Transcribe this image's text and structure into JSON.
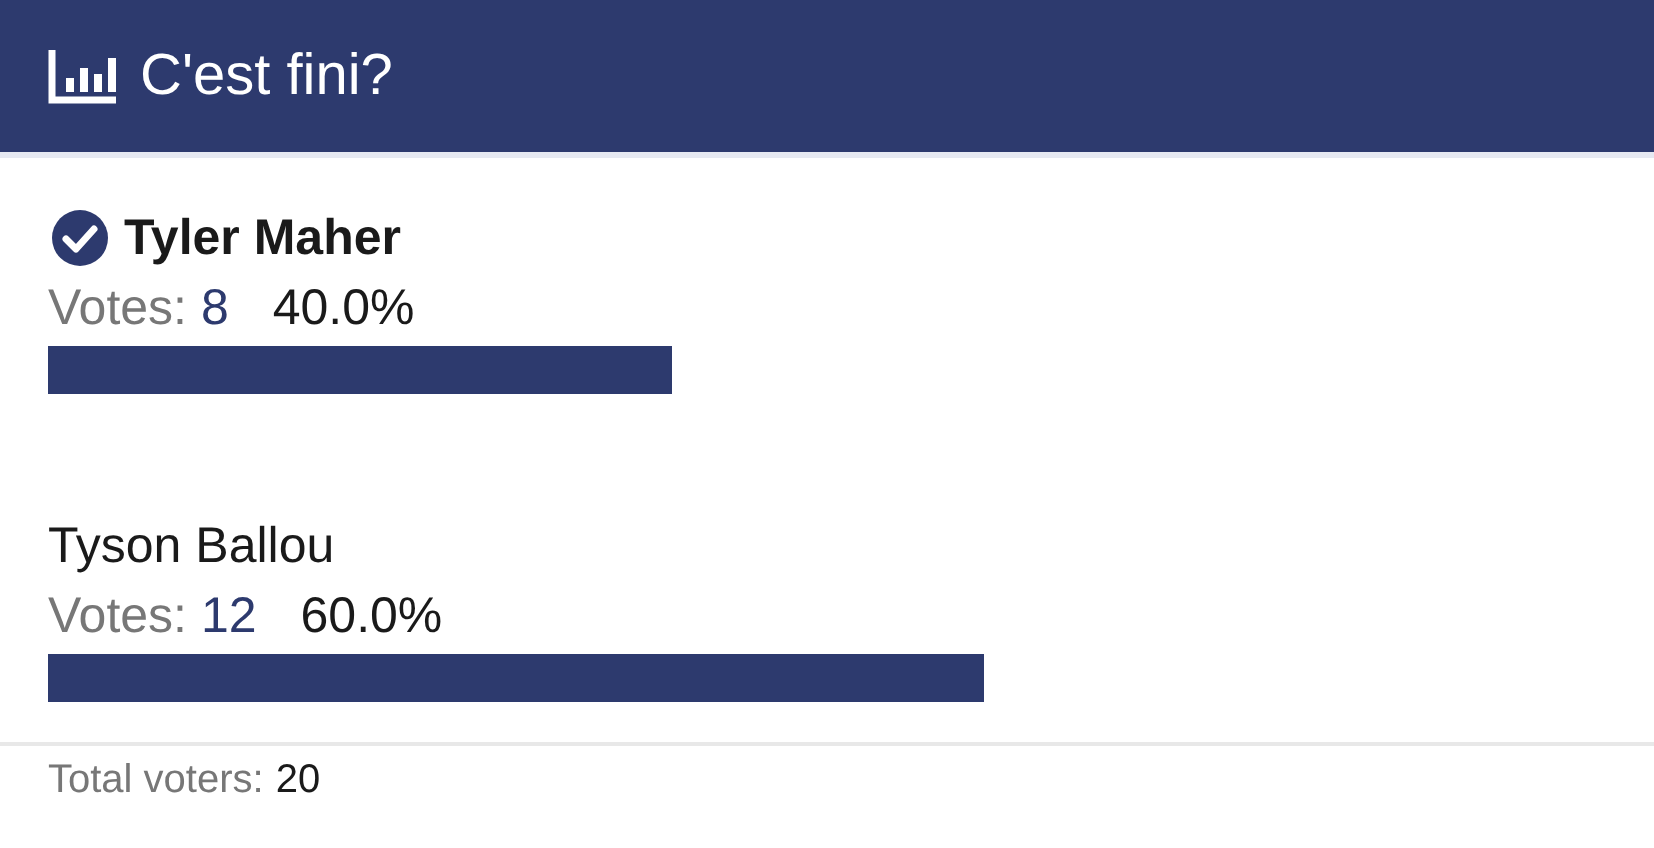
{
  "header": {
    "title": "C'est fini?"
  },
  "options": [
    {
      "name": "Tyler Maher",
      "selected": true,
      "votes_label": "Votes:",
      "votes": "8",
      "percent": "40.0%"
    },
    {
      "name": "Tyson Ballou",
      "selected": false,
      "votes_label": "Votes:",
      "votes": "12",
      "percent": "60.0%"
    }
  ],
  "footer": {
    "label": "Total voters:",
    "value": "20"
  }
}
